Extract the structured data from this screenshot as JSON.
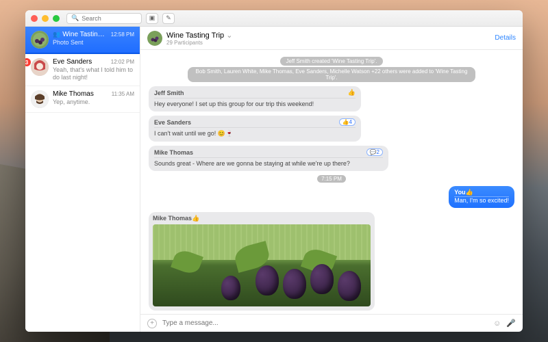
{
  "search": {
    "placeholder": "Search"
  },
  "sidebar": {
    "items": [
      {
        "name": "Wine Tasting Trip",
        "time": "12:58 PM",
        "sub": "Photo Sent",
        "group": true
      },
      {
        "name": "Eve Sanders",
        "time": "12:02 PM",
        "sub": "Yeah, that's what I told him to do last night!",
        "badge": "3"
      },
      {
        "name": "Mike Thomas",
        "time": "11:35 AM",
        "sub": "Yep, anytime."
      }
    ]
  },
  "header": {
    "title": "Wine Tasting Trip",
    "sub": "29 Participants",
    "details": "Details",
    "chev": "⌄"
  },
  "sys": [
    "Jeff Smith created 'Wine Tasting Trip'.",
    "Bob Smith, Lauren White, Mike Thomas, Eve Sanders, Michelle Watson +22 others were added to 'Wine Tasting Trip'."
  ],
  "msgs": [
    {
      "sender": "Jeff Smith",
      "text": "Hey everyone! I set up this group for our trip this weekend!"
    },
    {
      "sender": "Eve Sanders",
      "text": "I can't wait until we go! 😊🍷",
      "react": "👍4"
    },
    {
      "sender": "Mike Thomas",
      "text": "Sounds great - Where are we gonna be staying at while we're up there?",
      "react": "💬2"
    }
  ],
  "timestamp": "7:15 PM",
  "mine": {
    "sender": "You",
    "text": "Man, I'm so excited!"
  },
  "photo": {
    "sender": "Mike Thomas"
  },
  "compose": {
    "placeholder": "Type a message..."
  }
}
